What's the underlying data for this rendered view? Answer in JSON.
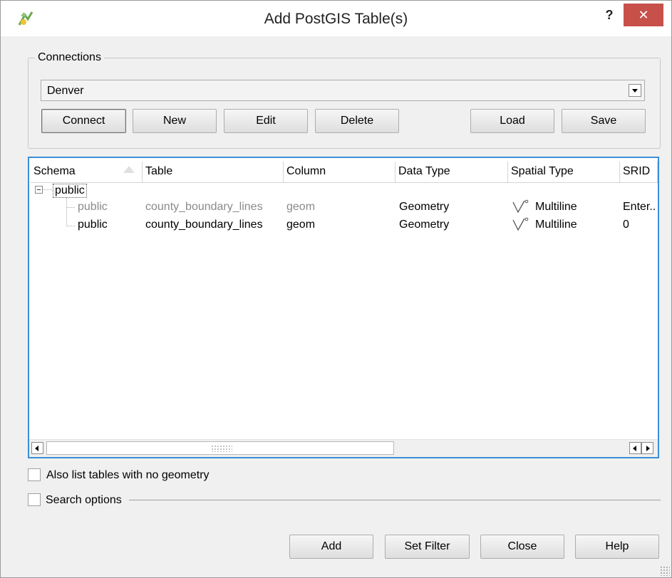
{
  "window": {
    "title": "Add PostGIS Table(s)",
    "help_label": "?",
    "close_label": "✕"
  },
  "connections": {
    "group_label": "Connections",
    "selected": "Denver",
    "buttons": {
      "connect": "Connect",
      "new": "New",
      "edit": "Edit",
      "delete": "Delete",
      "load": "Load",
      "save": "Save"
    }
  },
  "tree": {
    "columns": [
      "Schema",
      "Table",
      "Column",
      "Data Type",
      "Spatial Type",
      "SRID"
    ],
    "root": "public",
    "rows": [
      {
        "schema": "public",
        "table": "county_boundary_lines",
        "column": "geom",
        "data_type": "Geometry",
        "spatial_type": "Multiline",
        "srid": "Enter..",
        "dimmed": true
      },
      {
        "schema": "public",
        "table": "county_boundary_lines",
        "column": "geom",
        "data_type": "Geometry",
        "spatial_type": "Multiline",
        "srid": "0",
        "dimmed": false
      }
    ]
  },
  "options": {
    "no_geometry_label": "Also list tables with no geometry",
    "no_geometry_checked": false,
    "search_options_label": "Search options",
    "search_options_checked": false
  },
  "footer": {
    "add": "Add",
    "set_filter": "Set Filter",
    "close": "Close",
    "help": "Help"
  },
  "colors": {
    "accent": "#3c8ed8",
    "close_button": "#c7504a"
  },
  "icons": {
    "app": "qgis-logo-icon",
    "spatial": "multiline-icon"
  }
}
